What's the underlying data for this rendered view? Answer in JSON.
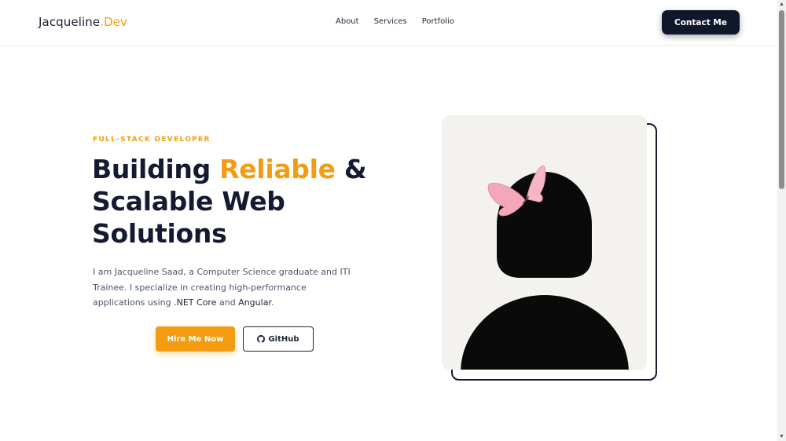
{
  "header": {
    "brand_main": "Jacqueline",
    "brand_dot_accent": ".Dev",
    "nav": [
      {
        "label": "About"
      },
      {
        "label": "Services"
      },
      {
        "label": "Portfolio"
      }
    ],
    "contact_label": "Contact Me"
  },
  "hero": {
    "eyebrow": "FULL-STACK DEVELOPER",
    "headline_part1": "Building ",
    "headline_highlight": "Reliable",
    "headline_part2": " & Scalable Web Solutions",
    "intro_part1": "I am Jacqueline Saad, a Computer Science graduate and ITI Trainee. I specialize in creating high-performance applications using ",
    "intro_tech1": ".NET Core",
    "intro_and": " and ",
    "intro_tech2": "Angular",
    "intro_end": ".",
    "hire_label": "Hire Me Now",
    "github_label": "GitHub"
  },
  "colors": {
    "accent": "#f39c12",
    "dark": "#0f172a",
    "butterfly": "#f4a7b9"
  },
  "icons": [
    "github-icon",
    "butterfly-icon"
  ]
}
